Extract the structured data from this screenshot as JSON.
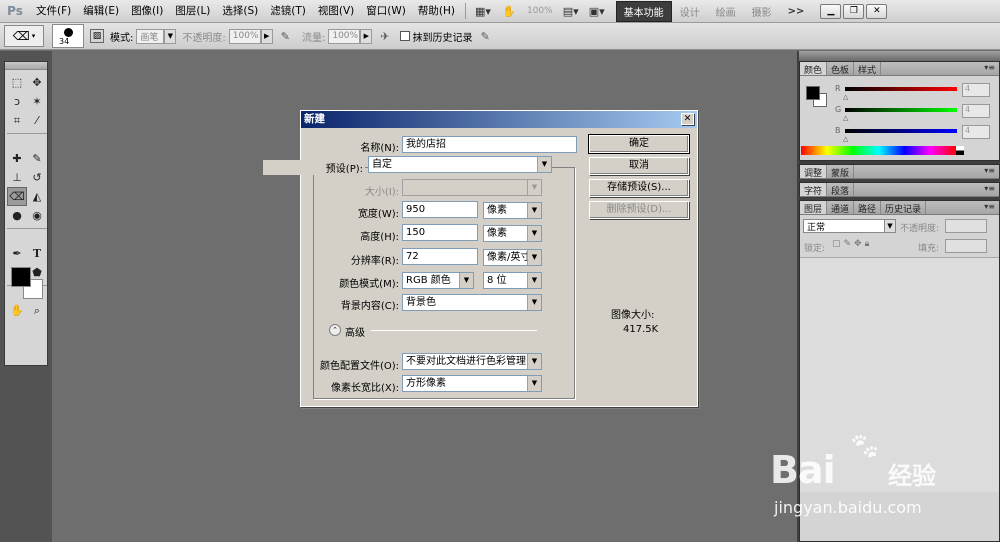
{
  "app": {
    "logo": "Ps",
    "menus": [
      "文件(F)",
      "编辑(E)",
      "图像(I)",
      "图层(L)",
      "选择(S)",
      "滤镜(T)",
      "视图(V)",
      "窗口(W)",
      "帮助(H)"
    ],
    "zoom": "100%",
    "workspace_active": "基本功能",
    "workspace_links": [
      "设计",
      "绘画",
      "摄影"
    ],
    "more": ">>"
  },
  "options": {
    "brush_size": "34",
    "mode_label": "模式:",
    "mode_value": "画笔",
    "opacity_label": "不透明度:",
    "opacity_value": "100%",
    "flow_label": "流量:",
    "flow_value": "100%",
    "erase_history": "抹到历史记录"
  },
  "panels": {
    "color_tabs": [
      "颜色",
      "色板",
      "样式"
    ],
    "rgb": [
      {
        "label": "R",
        "value": "4"
      },
      {
        "label": "G",
        "value": "4"
      },
      {
        "label": "B",
        "value": "4"
      }
    ],
    "adjust_tabs": [
      "调整",
      "蒙版"
    ],
    "char_tabs": [
      "字符",
      "段落"
    ],
    "layers_tabs": [
      "图层",
      "通道",
      "路径",
      "历史记录"
    ],
    "blend_mode": "正常",
    "opacity_label": "不透明度:",
    "lock_label": "锁定:",
    "fill_label": "填充:"
  },
  "dialog": {
    "title": "新建",
    "name_label": "名称(N):",
    "name_value": "我的店招",
    "preset_label": "预设(P):",
    "preset_value": "自定",
    "size_label": "大小(I):",
    "width_label": "宽度(W):",
    "width_value": "950",
    "width_unit": "像素",
    "height_label": "高度(H):",
    "height_value": "150",
    "height_unit": "像素",
    "resolution_label": "分辨率(R):",
    "resolution_value": "72",
    "resolution_unit": "像素/英寸",
    "color_mode_label": "颜色模式(M):",
    "color_mode_value": "RGB 颜色",
    "bit_depth": "8 位",
    "bg_label": "背景内容(C):",
    "bg_value": "背景色",
    "advanced": "高级",
    "profile_label": "颜色配置文件(O):",
    "profile_value": "不要对此文档进行色彩管理",
    "pixel_aspect_label": "像素长宽比(X):",
    "pixel_aspect_value": "方形像素",
    "btn_ok": "确定",
    "btn_cancel": "取消",
    "btn_save_preset": "存储预设(S)...",
    "btn_delete_preset": "删除预设(D)...",
    "image_size_label": "图像大小:",
    "image_size_value": "417.5K"
  },
  "watermark": {
    "brand": "Bai",
    "brand2": "经验",
    "url": "jingyan.baidu.com"
  }
}
